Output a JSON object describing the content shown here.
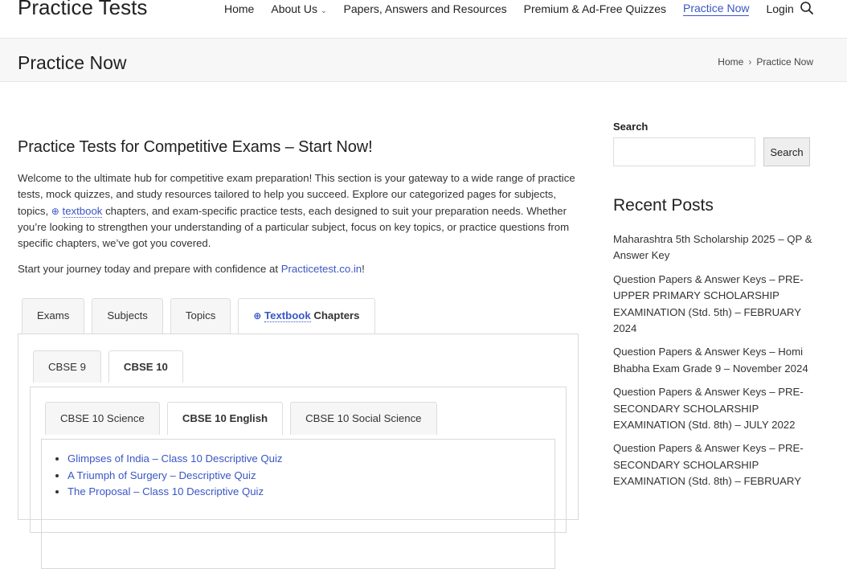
{
  "header": {
    "site_title": "Practice Tests",
    "nav": {
      "home": "Home",
      "about": "About Us",
      "papers": "Papers, Answers and Resources",
      "premium": "Premium & Ad-Free Quizzes",
      "practice": "Practice Now",
      "login": "Login"
    },
    "active_item": "Practice Now",
    "accent_color": "#3a56c5"
  },
  "title_bar": {
    "page_title": "Practice Now",
    "breadcrumb": [
      "Home",
      "Practice Now"
    ]
  },
  "content": {
    "heading": "Practice Tests for Competitive Exams – Start Now!",
    "intro": {
      "part1": "Welcome to the ultimate hub for competitive exam preparation! This section is your gateway to a wide range of practice tests, mock quizzes, and study resources tailored to help you succeed. Explore our categorized pages for subjects, topics,",
      "link": "textbook",
      "part2": "chapters, and exam-specific practice tests, each designed to suit your preparation needs. Whether you’re looking to strengthen your understanding of a particular subject, focus on key topics, or practice questions from specific chapters, we’ve got you covered."
    },
    "journey": {
      "text": "Start your journey today and prepare with confidence at",
      "link": "Practicetest.co.in",
      "end": "!"
    },
    "tabs_level1": {
      "exams": "Exams",
      "subjects": "Subjects",
      "topics": "Topics",
      "textbook_link": "Textbook",
      "chapters": "Chapters"
    },
    "tabs_level2": {
      "cbse9": "CBSE 9",
      "cbse10": "CBSE 10"
    },
    "tabs_level3": {
      "science": "CBSE 10 Science",
      "english": "CBSE 10 English",
      "social": "CBSE 10 Social Science"
    },
    "quizzes": [
      "Glimpses of India – Class 10 Descriptive Quiz",
      "A Triumph of Surgery – Descriptive Quiz",
      "The Proposal – Class 10 Descriptive Quiz"
    ]
  },
  "sidebar": {
    "search_label": "Search",
    "search_value": "",
    "search_button": "Search",
    "recent_title": "Recent Posts",
    "recent_posts": [
      "Maharashtra 5th Scholarship 2025 – QP & Answer Key",
      "Question Papers & Answer Keys – PRE-UPPER PRIMARY SCHOLARSHIP EXAMINATION (Std. 5th) – FEBRUARY 2024",
      "Question Papers & Answer Keys – Homi Bhabha Exam Grade 9 – November 2024",
      "Question Papers & Answer Keys – PRE-SECONDARY SCHOLARSHIP EXAMINATION (Std. 8th) – JULY 2022",
      "Question Papers & Answer Keys – PRE-SECONDARY SCHOLARSHIP EXAMINATION (Std. 8th) – FEBRUARY"
    ]
  }
}
